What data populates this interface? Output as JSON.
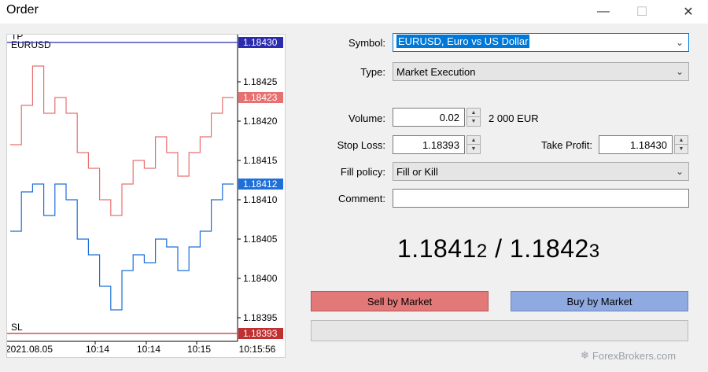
{
  "window": {
    "title": "Order",
    "min_icon": "minimize-icon",
    "max_icon": "maximize-icon",
    "close_icon": "close-icon"
  },
  "chart": {
    "symbol": "EURUSD",
    "tp_label": "TP",
    "sl_label": "SL",
    "tp_price": "1.18430",
    "sl_price": "1.18393",
    "ask_price": "1.18423",
    "bid_price": "1.18412",
    "y_ticks": [
      "1.18425",
      "1.18420",
      "1.18415",
      "1.18410",
      "1.18405",
      "1.18400",
      "1.18395"
    ],
    "x_ticks": [
      "2021.08.05",
      "10:14",
      "10:14",
      "10:15",
      "10:15:56"
    ],
    "colors": {
      "ask": "#e87070",
      "bid": "#1e6fd9",
      "tp": "#2b2bb0",
      "sl": "#c03030"
    }
  },
  "chart_data": {
    "type": "line",
    "x": [
      0,
      5,
      10,
      15,
      20,
      25,
      30,
      35,
      40,
      45,
      50,
      55,
      60,
      65,
      70,
      75,
      80,
      85,
      90,
      95,
      100
    ],
    "series": [
      {
        "values": [
          1.18406,
          1.18411,
          1.18412,
          1.18408,
          1.18412,
          1.1841,
          1.18405,
          1.18403,
          1.18399,
          1.18396,
          1.18401,
          1.18403,
          1.18402,
          1.18405,
          1.18404,
          1.18401,
          1.18404,
          1.18406,
          1.1841,
          1.18412,
          1.18412
        ]
      },
      {
        "values": [
          1.18417,
          1.18422,
          1.18427,
          1.18421,
          1.18423,
          1.18421,
          1.18416,
          1.18414,
          1.1841,
          1.18408,
          1.18412,
          1.18415,
          1.18414,
          1.18418,
          1.18416,
          1.18413,
          1.18416,
          1.18418,
          1.18421,
          1.18423,
          1.18423
        ]
      }
    ],
    "ylim": [
      1.18392,
      1.18431
    ],
    "levels": {
      "tp": 1.1843,
      "sl": 1.18393
    }
  },
  "form": {
    "symbol_label": "Symbol:",
    "symbol_value": "EURUSD, Euro vs US Dollar",
    "type_label": "Type:",
    "type_value": "Market Execution",
    "volume_label": "Volume:",
    "volume_value": "0.02",
    "volume_note": "2 000 EUR",
    "sl_label": "Stop Loss:",
    "sl_value": "1.18393",
    "tp_label": "Take Profit:",
    "tp_value": "1.18430",
    "fill_label": "Fill policy:",
    "fill_value": "Fill or Kill",
    "comment_label": "Comment:",
    "comment_value": ""
  },
  "quote": {
    "bid_main": "1.1841",
    "bid_small": "2",
    "separator": " / ",
    "ask_main": "1.1842",
    "ask_small": "3"
  },
  "buttons": {
    "sell": "Sell by Market",
    "buy": "Buy by Market"
  },
  "watermark": "ForexBrokers.com"
}
